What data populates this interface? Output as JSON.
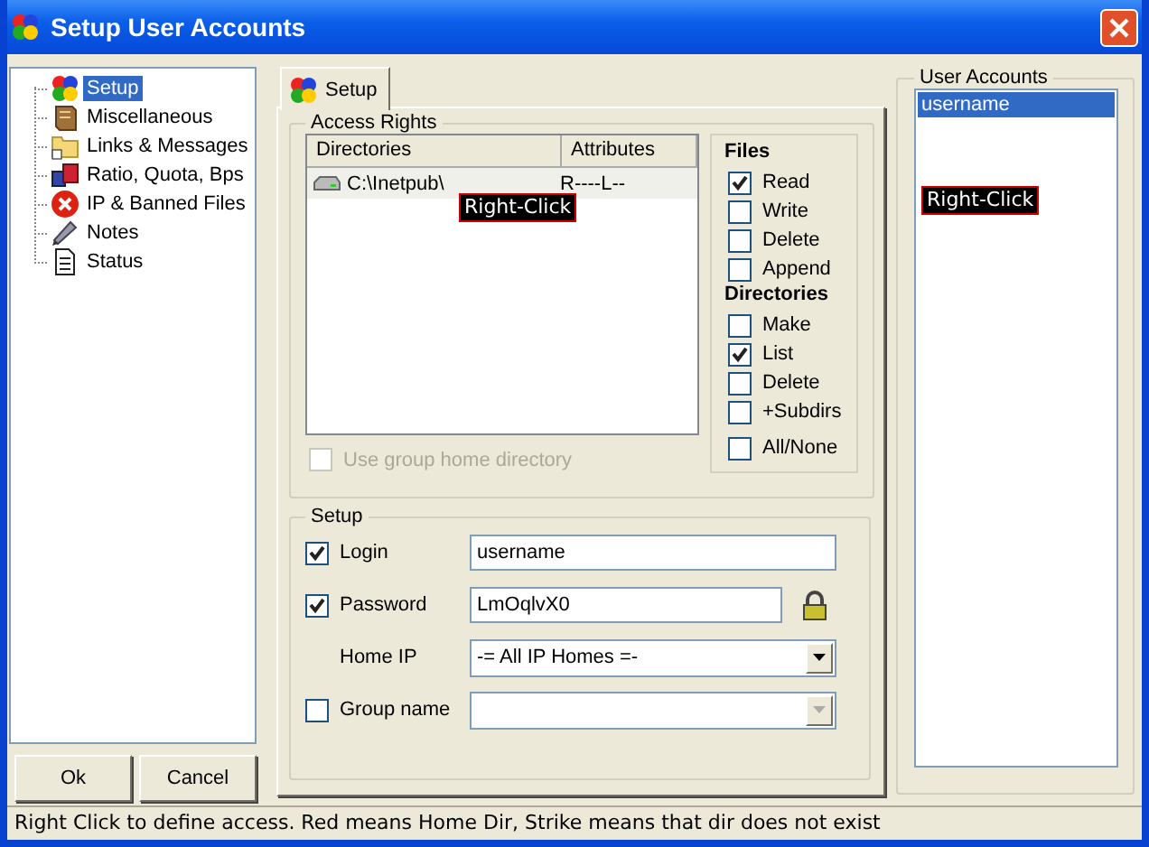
{
  "window": {
    "title": "Setup User Accounts"
  },
  "tree": {
    "items": [
      {
        "label": "Setup",
        "selected": true
      },
      {
        "label": "Miscellaneous",
        "selected": false
      },
      {
        "label": "Links & Messages",
        "selected": false
      },
      {
        "label": "Ratio, Quota, Bps",
        "selected": false
      },
      {
        "label": "IP & Banned Files",
        "selected": false
      },
      {
        "label": "Notes",
        "selected": false
      },
      {
        "label": "Status",
        "selected": false
      }
    ]
  },
  "tabs": [
    {
      "label": "Setup",
      "selected": true
    }
  ],
  "access_rights": {
    "title": "Access Rights",
    "columns": [
      "Directories",
      "Attributes"
    ],
    "rows": [
      {
        "directory": "C:\\Inetpub\\",
        "attributes": "R----L--",
        "selected": true
      }
    ],
    "tooltip": "Right-Click",
    "use_group_home": {
      "label": "Use group home directory",
      "checked": false,
      "disabled": true
    },
    "files": {
      "title": "Files",
      "options": [
        {
          "label": "Read",
          "checked": true
        },
        {
          "label": "Write",
          "checked": false
        },
        {
          "label": "Delete",
          "checked": false
        },
        {
          "label": "Append",
          "checked": false
        }
      ]
    },
    "directories": {
      "title": "Directories",
      "options": [
        {
          "label": "Make",
          "checked": false
        },
        {
          "label": "List",
          "checked": true
        },
        {
          "label": "Delete",
          "checked": false
        },
        {
          "label": "+Subdirs",
          "checked": false
        }
      ]
    },
    "all_none": {
      "label": "All/None",
      "checked": false
    }
  },
  "setup": {
    "title": "Setup",
    "login": {
      "label": "Login",
      "checked": true,
      "value": "username"
    },
    "password": {
      "label": "Password",
      "checked": true,
      "value": "LmOqlvX0"
    },
    "home_ip": {
      "label": "Home IP",
      "value": "-= All IP Homes =-"
    },
    "group_name": {
      "label": "Group name",
      "checked": false,
      "disabled": true
    }
  },
  "buttons": [
    "Ok",
    "Cancel"
  ],
  "user_accounts": {
    "title": "User Accounts",
    "items": [
      {
        "label": "username",
        "selected": true
      }
    ],
    "tooltip": "Right-Click"
  },
  "status_bar": "Right Click to define access. Red means Home Dir, Strike means that dir does not exist"
}
